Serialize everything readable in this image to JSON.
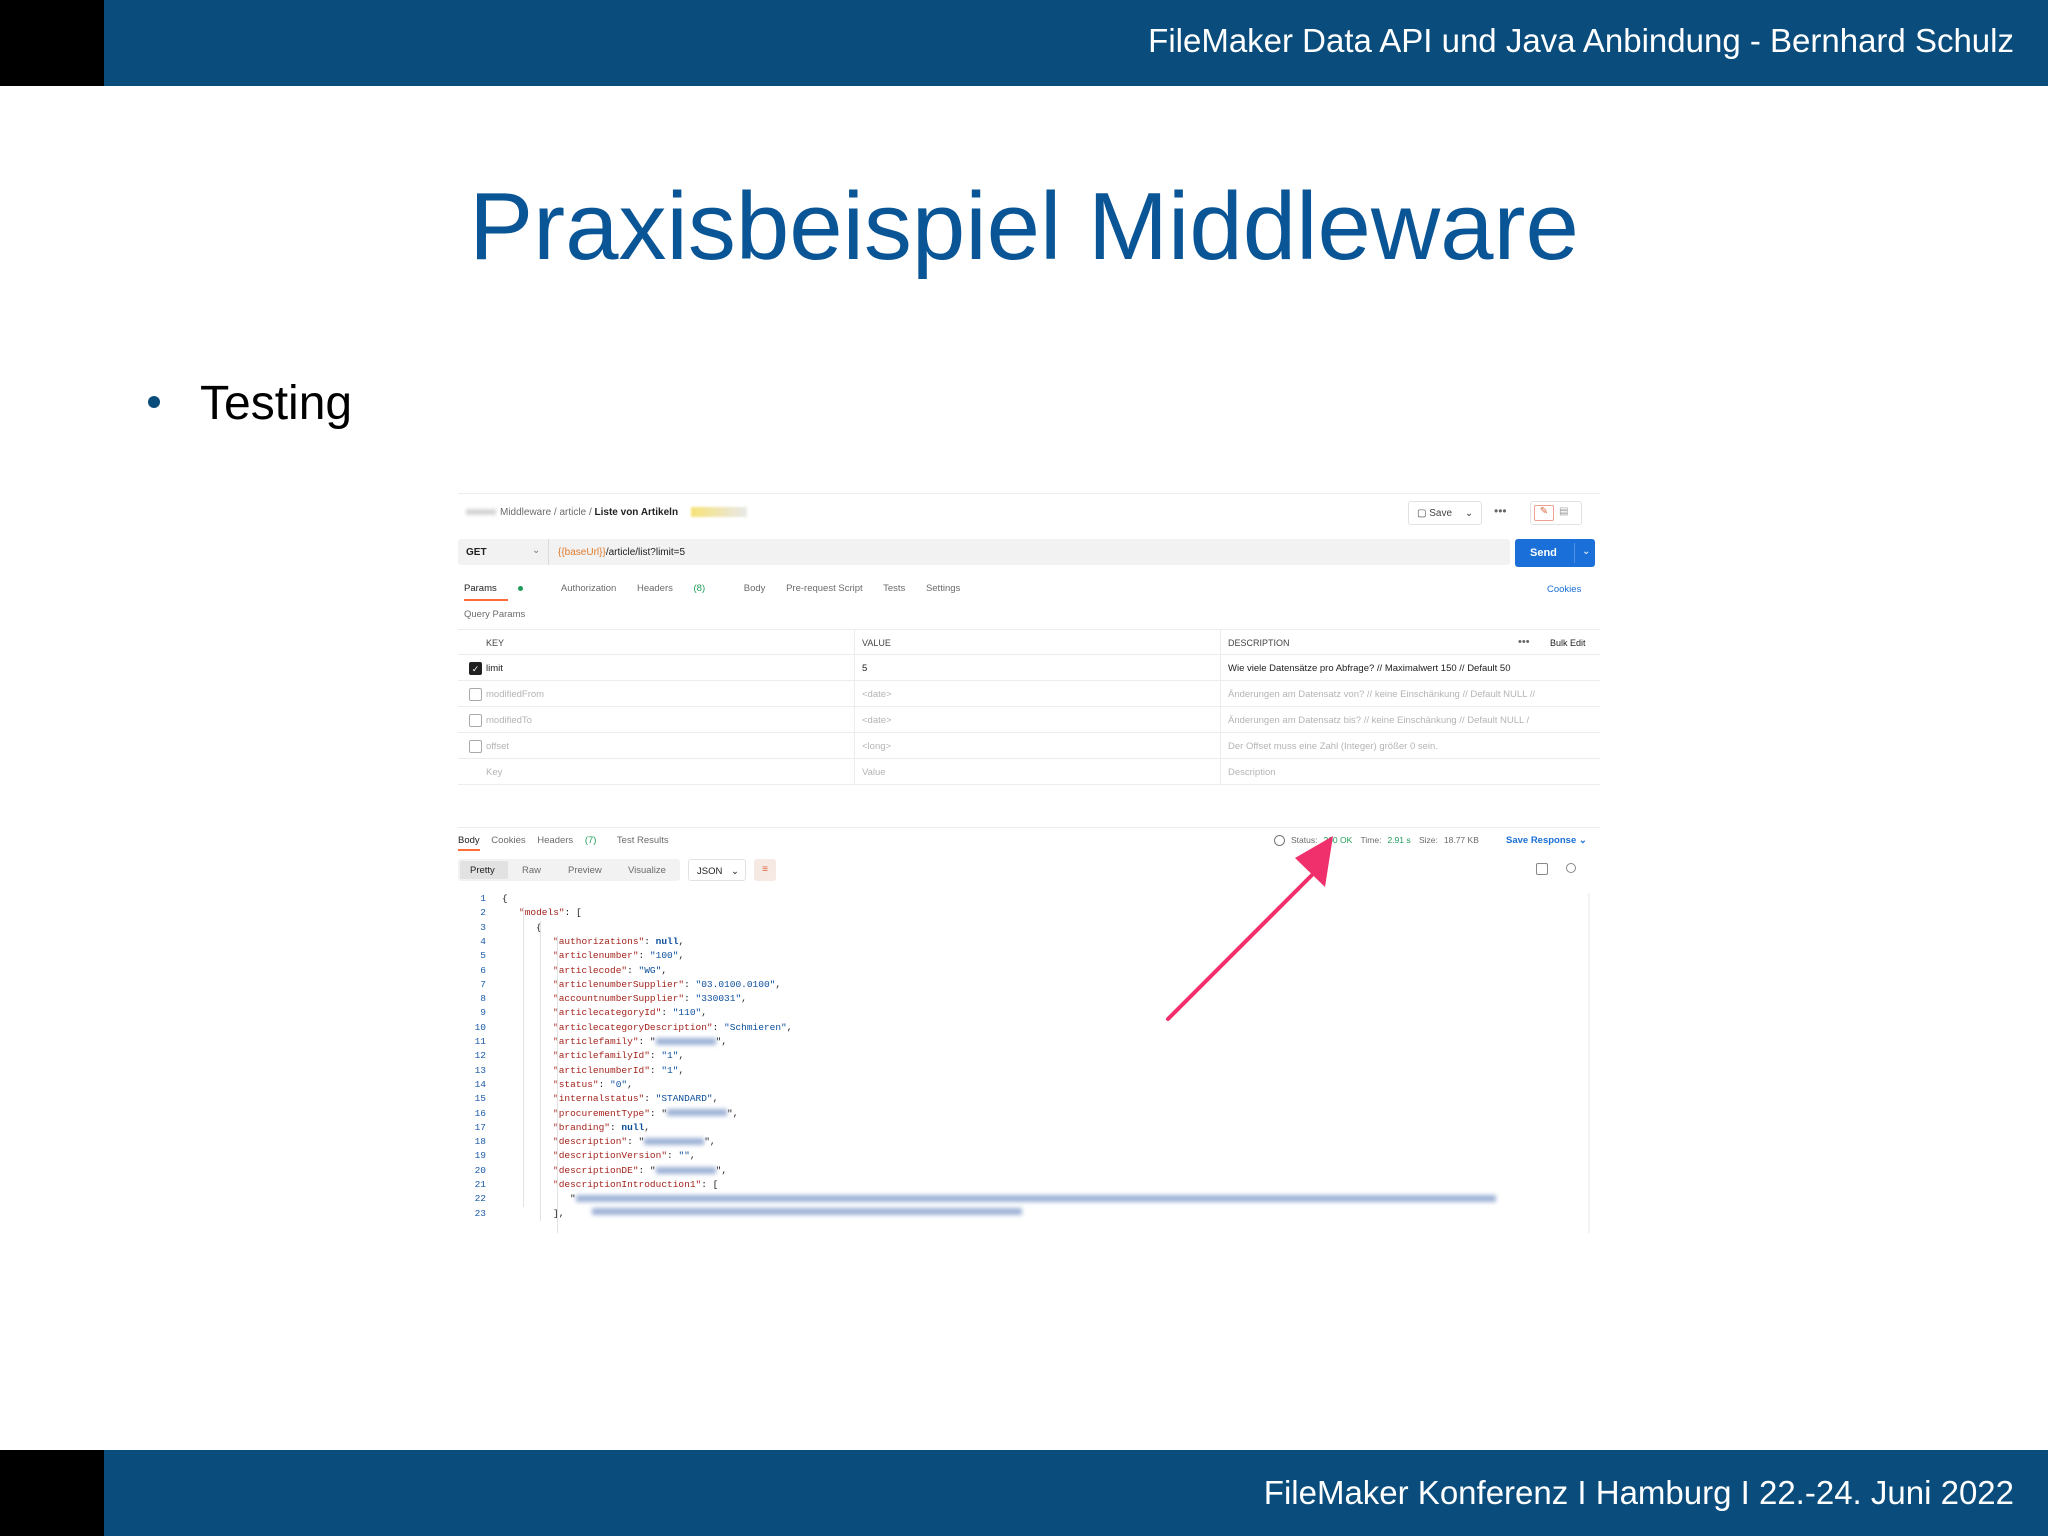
{
  "header": {
    "title": "FileMaker Data API und Java Anbindung - Bernhard Schulz"
  },
  "slide": {
    "title": "Praxisbeispiel Middleware",
    "bullet": "Testing"
  },
  "footer": {
    "text": "FileMaker Konferenz I Hamburg I  22.-24. Juni 2022"
  },
  "postman": {
    "breadcrumb": {
      "sep": "/",
      "middleware": "Middleware",
      "article": "article",
      "current": "Liste von Artikeln"
    },
    "save_label": "Save",
    "method": "GET",
    "url_var": "{{baseUrl}}",
    "url_path": "/article/list?limit=5",
    "send_label": "Send",
    "request_tabs": [
      {
        "label": "Params"
      },
      {
        "label": "Authorization"
      },
      {
        "label": "Headers",
        "count": "(8)"
      },
      {
        "label": "Body"
      },
      {
        "label": "Pre-request Script"
      },
      {
        "label": "Tests"
      },
      {
        "label": "Settings"
      }
    ],
    "cookies_label": "Cookies",
    "query_params_title": "Query Params",
    "table": {
      "headers": {
        "key": "KEY",
        "value": "VALUE",
        "description": "DESCRIPTION",
        "bulk_edit": "Bulk Edit"
      },
      "rows": [
        {
          "key": "limit",
          "value": "5",
          "description": "Wie viele Datensätze pro Abfrage? // Maximalwert 150 // Default 50",
          "checked": true
        },
        {
          "key": "modifiedFrom",
          "value": "<date>",
          "description": "Änderungen am Datensatz von? // keine Einschänkung // Default NULL //",
          "checked": false
        },
        {
          "key": "modifiedTo",
          "value": "<date>",
          "description": "Änderungen am Datensatz bis? // keine Einschänkung // Default NULL /",
          "checked": false
        },
        {
          "key": "offset",
          "value": "<long>",
          "description": "Der Offset muss eine Zahl (Integer) größer 0 sein.",
          "checked": false
        }
      ],
      "placeholder": {
        "key": "Key",
        "value": "Value",
        "description": "Description"
      }
    },
    "response_tabs": [
      {
        "label": "Body"
      },
      {
        "label": "Cookies"
      },
      {
        "label": "Headers",
        "count": "(7)"
      },
      {
        "label": "Test Results"
      }
    ],
    "status": {
      "status_label": "Status:",
      "status_value": "200 OK",
      "time_label": "Time:",
      "time_value": "2.91 s",
      "size_label": "Size:",
      "size_value": "18.77 KB"
    },
    "save_response_label": "Save Response",
    "format_tabs": [
      "Pretty",
      "Raw",
      "Preview",
      "Visualize"
    ],
    "format_select": "JSON",
    "code_lines": [
      {
        "n": "1",
        "key": "",
        "val": "{",
        "indent": 0
      },
      {
        "n": "2",
        "key": "\"models\"",
        "val": ": [",
        "indent": 1
      },
      {
        "n": "3",
        "key": "",
        "val": "{",
        "indent": 2
      },
      {
        "n": "4",
        "key": "\"authorizations\"",
        "val": "null",
        "type": "n",
        "indent": 3
      },
      {
        "n": "5",
        "key": "\"articlenumber\"",
        "val": "\"100\"",
        "type": "s",
        "indent": 3
      },
      {
        "n": "6",
        "key": "\"articlecode\"",
        "val": "\"WG\"",
        "type": "s",
        "indent": 3
      },
      {
        "n": "7",
        "key": "\"articlenumberSupplier\"",
        "val": "\"03.0100.0100\"",
        "type": "s",
        "indent": 3
      },
      {
        "n": "8",
        "key": "\"accountnumberSupplier\"",
        "val": "\"330031\"",
        "type": "s",
        "indent": 3
      },
      {
        "n": "9",
        "key": "\"articlecategoryId\"",
        "val": "\"110\"",
        "type": "s",
        "indent": 3
      },
      {
        "n": "10",
        "key": "\"articlecategoryDescription\"",
        "val": "\"Schmieren\"",
        "type": "s",
        "indent": 3
      },
      {
        "n": "11",
        "key": "\"articlefamily\"",
        "val": "",
        "type": "blur",
        "indent": 3
      },
      {
        "n": "12",
        "key": "\"articlefamilyId\"",
        "val": "\"1\"",
        "type": "s",
        "indent": 3
      },
      {
        "n": "13",
        "key": "\"articlenumberId\"",
        "val": "\"1\"",
        "type": "s",
        "indent": 3
      },
      {
        "n": "14",
        "key": "\"status\"",
        "val": "\"0\"",
        "type": "s",
        "indent": 3
      },
      {
        "n": "15",
        "key": "\"internalstatus\"",
        "val": "\"STANDARD\"",
        "type": "s",
        "indent": 3
      },
      {
        "n": "16",
        "key": "\"procurementType\"",
        "val": "",
        "type": "blur",
        "indent": 3
      },
      {
        "n": "17",
        "key": "\"branding\"",
        "val": "null",
        "type": "n",
        "indent": 3
      },
      {
        "n": "18",
        "key": "\"description\"",
        "val": "",
        "type": "blur",
        "indent": 3
      },
      {
        "n": "19",
        "key": "\"descriptionVersion\"",
        "val": "\"\"",
        "type": "s",
        "indent": 3
      },
      {
        "n": "20",
        "key": "\"descriptionDE\"",
        "val": "",
        "type": "blur",
        "indent": 3
      },
      {
        "n": "21",
        "key": "\"descriptionIntroduction1\"",
        "val": ": [",
        "type": "open",
        "indent": 3
      },
      {
        "n": "22",
        "key": "",
        "val": "",
        "type": "blurline",
        "indent": 4
      },
      {
        "n": "23",
        "key": "",
        "val": "],",
        "indent": 3
      }
    ],
    "colors": {
      "send": "#1a70d8",
      "accent": "#ff6c37",
      "status_ok": "#1e9c57",
      "arrow": "#f0306c"
    }
  }
}
